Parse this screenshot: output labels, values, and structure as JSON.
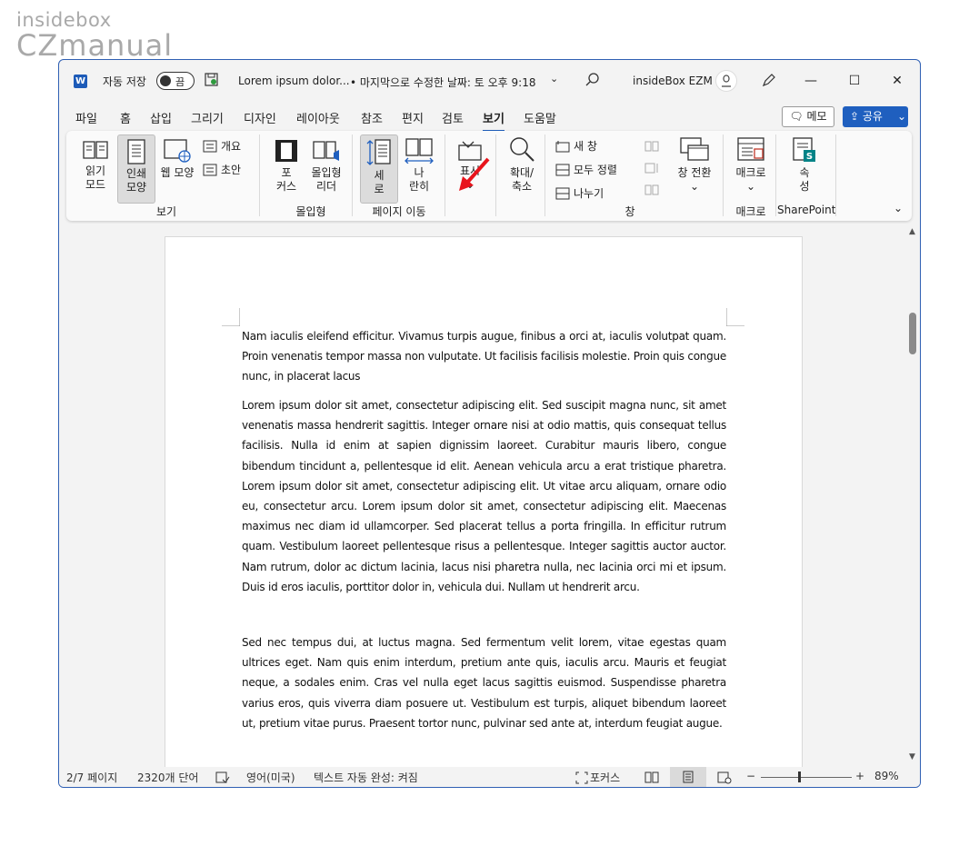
{
  "watermark": {
    "line1": "insidebox",
    "line2": "CZmanual"
  },
  "titlebar": {
    "app_icon": "W",
    "autosave_label": "자동 저장",
    "autosave_state": "끔",
    "doc_title": "Lorem ipsum dolor...",
    "doc_status": "• 마지막으로 수정한 날짜: 토 오후 9:18",
    "user_name": "insideBox EZM",
    "minimize": "—",
    "maximize": "☐",
    "close": "✕"
  },
  "tabs": [
    "파일",
    "홈",
    "삽입",
    "그리기",
    "디자인",
    "레이아웃",
    "참조",
    "편지",
    "검토",
    "보기",
    "도움말"
  ],
  "active_tab": "보기",
  "memo_button": "메모",
  "share_button": "공유",
  "ribbon": {
    "groups": {
      "view": "보기",
      "immersive": "몰입형",
      "page_move": "페이지 이동",
      "window": "창",
      "macro": "매크로",
      "sharepoint": "SharePoint"
    },
    "buttons": {
      "read_mode": [
        "읽기",
        "모드"
      ],
      "print_layout": [
        "인쇄",
        "모양"
      ],
      "web_layout": "웹 모양",
      "outline": "개요",
      "draft": "초안",
      "focus": [
        "포",
        "커스"
      ],
      "immersive_reader": [
        "몰입형",
        "리더"
      ],
      "vertical": [
        "세",
        "로"
      ],
      "side_by_side": [
        "나",
        "란히"
      ],
      "show": "표시",
      "zoom": [
        "확대/",
        "축소"
      ],
      "new_window": "새 창",
      "arrange_all": "모두 정렬",
      "split": "나누기",
      "switch_windows": "창 전환",
      "macros": "매크로",
      "properties": [
        "속",
        "성"
      ]
    }
  },
  "document": {
    "paragraphs": [
      "Nam iaculis eleifend efficitur. Vivamus turpis augue, finibus a orci at, iaculis volutpat quam. Proin venenatis tempor massa non vulputate. Ut facilisis facilisis molestie. Proin quis congue nunc, in placerat lacus",
      "Lorem ipsum dolor sit amet, consectetur adipiscing elit. Sed suscipit magna nunc, sit amet venenatis massa hendrerit sagittis. Integer ornare nisi at odio mattis, quis consequat tellus facilisis. Nulla id enim at sapien dignissim laoreet. Curabitur mauris libero, congue bibendum tincidunt a, pellentesque id elit. Aenean vehicula arcu a erat tristique pharetra. Lorem ipsum dolor sit amet, consectetur adipiscing elit. Ut vitae arcu aliquam, ornare odio eu, consectetur arcu. Lorem ipsum dolor sit amet, consectetur adipiscing elit. Maecenas maximus nec diam id ullamcorper. Sed placerat tellus a porta fringilla. In efficitur rutrum quam. Vestibulum laoreet pellentesque risus a pellentesque. Integer sagittis auctor auctor. Nam rutrum, dolor ac dictum lacinia, lacus nisi pharetra nulla, nec lacinia orci mi et ipsum. Duis id eros iaculis, porttitor dolor in, vehicula dui. Nullam ut hendrerit arcu.",
      "Sed nec tempus dui, at luctus magna. Sed fermentum velit lorem, vitae egestas quam ultrices eget. Nam quis enim interdum, pretium ante quis, iaculis arcu. Mauris et feugiat neque, a sodales enim. Cras vel nulla eget lacus sagittis euismod. Suspendisse pharetra varius eros, quis viverra diam posuere ut. Vestibulum est turpis, aliquet bibendum laoreet ut, pretium vitae purus. Praesent tortor nunc, pulvinar sed ante at, interdum feugiat augue."
    ]
  },
  "statusbar": {
    "page": "2/7 페이지",
    "words": "2320개 단어",
    "language": "영어(미국)",
    "autocomplete": "텍스트 자동 완성: 켜짐",
    "focus": "포커스",
    "zoom_minus": "−",
    "zoom_plus": "+",
    "zoom": "89%"
  },
  "colors": {
    "accent": "#1f5fbf",
    "annotation_arrow": "#e8141c"
  }
}
